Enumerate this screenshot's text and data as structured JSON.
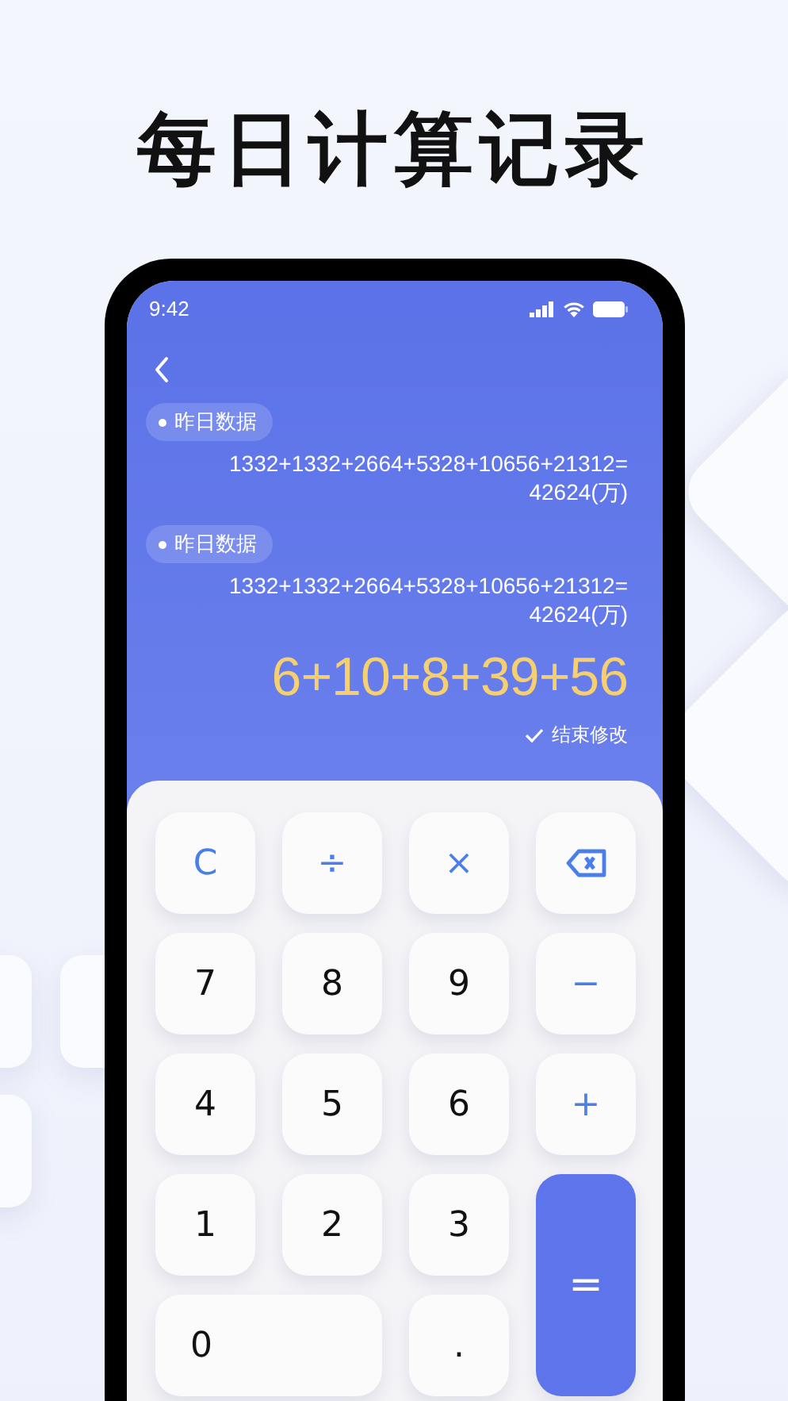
{
  "headline": "每日计算记录",
  "status_bar": {
    "time": "9:42"
  },
  "records": [
    {
      "tag": "昨日数据",
      "equation": "1332+1332+2664+5328+10656+21312=\n42624(万)"
    },
    {
      "tag": "昨日数据",
      "equation": "1332+1332+2664+5328+10656+21312=\n42624(万)"
    }
  ],
  "current_input": "6+10+8+39+56",
  "finish_edit": "结束修改",
  "keys": [
    {
      "kind": "function",
      "label": "C"
    },
    {
      "kind": "function",
      "label": "÷"
    },
    {
      "kind": "function",
      "label": "×"
    },
    {
      "kind": "backspace"
    },
    {
      "kind": "digit",
      "label": "7"
    },
    {
      "kind": "digit",
      "label": "8"
    },
    {
      "kind": "digit",
      "label": "9"
    },
    {
      "kind": "function",
      "label": "−"
    },
    {
      "kind": "digit",
      "label": "4"
    },
    {
      "kind": "digit",
      "label": "5"
    },
    {
      "kind": "digit",
      "label": "6"
    },
    {
      "kind": "function",
      "label": "+"
    },
    {
      "kind": "digit",
      "label": "1"
    },
    {
      "kind": "digit",
      "label": "2"
    },
    {
      "kind": "digit",
      "label": "3"
    },
    {
      "kind": "equals",
      "label": "="
    },
    {
      "kind": "zero",
      "label": "0"
    },
    {
      "kind": "digit",
      "label": "."
    }
  ]
}
